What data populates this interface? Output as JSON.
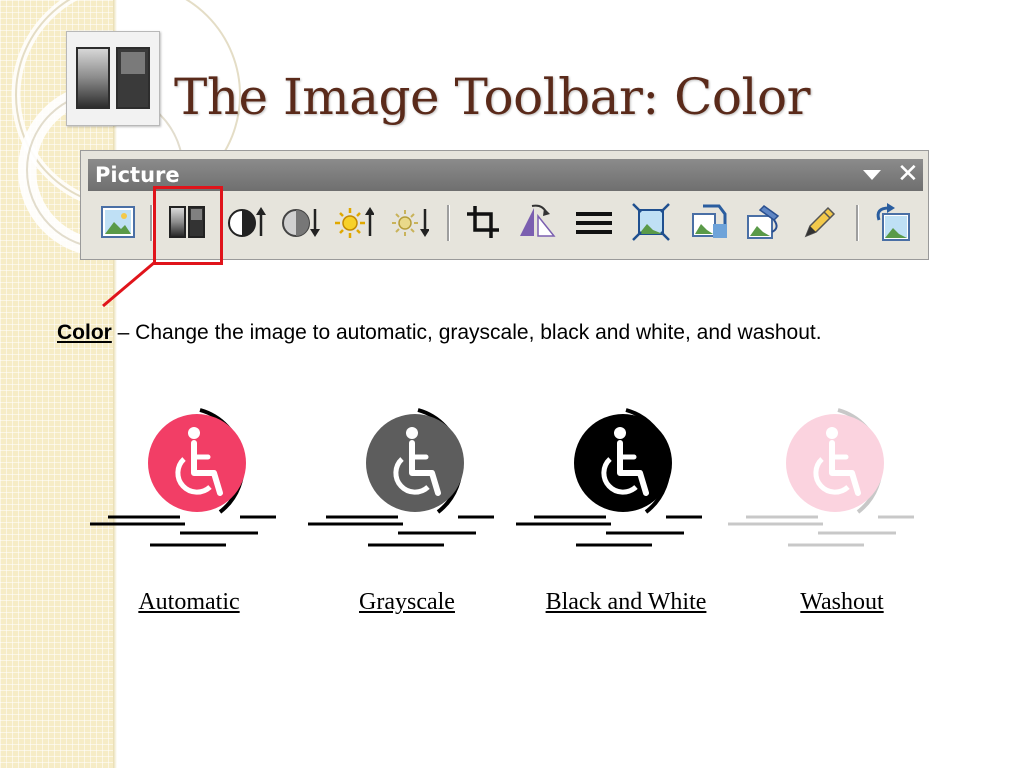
{
  "slide": {
    "title": "The Image Toolbar: Color"
  },
  "toolbar": {
    "title": "Picture",
    "menu_icon": "dropdown-arrow-icon",
    "close_icon": "close-icon",
    "close_glyph": "✕",
    "buttons": [
      {
        "name": "insert-picture-button",
        "icon": "insert-picture-icon"
      },
      {
        "name": "color-button",
        "icon": "color-icon",
        "highlighted": true
      },
      {
        "name": "more-contrast-button",
        "icon": "more-contrast-icon"
      },
      {
        "name": "less-contrast-button",
        "icon": "less-contrast-icon"
      },
      {
        "name": "more-brightness-button",
        "icon": "more-brightness-icon"
      },
      {
        "name": "less-brightness-button",
        "icon": "less-brightness-icon"
      },
      {
        "name": "crop-button",
        "icon": "crop-icon"
      },
      {
        "name": "rotate-left-button",
        "icon": "rotate-left-icon"
      },
      {
        "name": "line-style-button",
        "icon": "line-style-icon"
      },
      {
        "name": "compress-pictures-button",
        "icon": "compress-pictures-icon"
      },
      {
        "name": "text-wrapping-button",
        "icon": "text-wrapping-icon"
      },
      {
        "name": "format-picture-button",
        "icon": "format-picture-icon"
      },
      {
        "name": "set-transparent-color-button",
        "icon": "set-transparent-color-icon"
      },
      {
        "name": "reset-picture-button",
        "icon": "reset-picture-icon"
      }
    ],
    "highlight_color": "#e0141b"
  },
  "description": {
    "term": "Color",
    "text": " – Change the image to automatic, grayscale, black and white, and washout."
  },
  "samples": [
    {
      "label": "Automatic",
      "icon": "wheelchair-icon",
      "fill": "#f23e66",
      "line": "#000000"
    },
    {
      "label": "Grayscale",
      "icon": "wheelchair-icon",
      "fill": "#5d5d5d",
      "line": "#000000"
    },
    {
      "label": "Black and White",
      "icon": "wheelchair-icon",
      "fill": "#000000",
      "line": "#000000"
    },
    {
      "label": "Washout",
      "icon": "wheelchair-icon",
      "fill": "#fbd3df",
      "line": "#c8c8c8"
    }
  ],
  "colors": {
    "title": "#5a2a1a",
    "strip": "#f6ecc6"
  }
}
